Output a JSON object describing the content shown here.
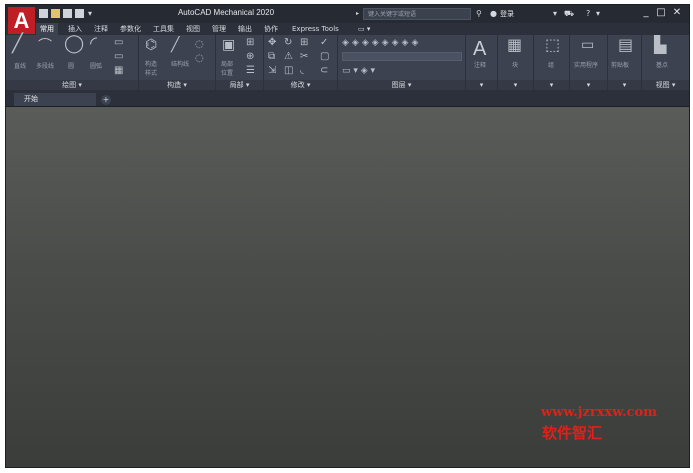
{
  "app": {
    "title": "AutoCAD Mechanical 2020",
    "logo_letter": "A"
  },
  "search": {
    "placeholder": "键入关键字或短语"
  },
  "account": {
    "login_label": "登录"
  },
  "ribbon_tabs": [
    "常用",
    "插入",
    "注释",
    "参数化",
    "工具集",
    "视图",
    "管理",
    "输出",
    "协作",
    "Express Tools"
  ],
  "ribbon": {
    "draw": {
      "title": "绘图 ▾",
      "line": "直线",
      "polyline": "多段线",
      "circle": "圆",
      "arc": "圆弧"
    },
    "construct": {
      "title": "构造 ▾",
      "structure": "构造",
      "line": "结构线",
      "style": "样式"
    },
    "detail": {
      "title": "局部 ▾",
      "label1": "局部",
      "label2": "位置"
    },
    "modify": {
      "title": "修改 ▾"
    },
    "layers": {
      "title": "图层 ▾"
    },
    "annotation": {
      "label": "注释"
    },
    "block": {
      "label": "块"
    },
    "group": {
      "label": "组"
    },
    "utilities": {
      "label": "实用程序"
    },
    "clipboard": {
      "label": "剪贴板"
    },
    "view": {
      "label": "基点",
      "title": "视图 ▾"
    }
  },
  "document_tabs": {
    "start": "开始",
    "new_tab": "+"
  },
  "window_controls": {
    "minimize": "_",
    "maximize": "□",
    "close": "✕"
  },
  "watermark": {
    "url": "www.jzrxxw.com",
    "name": "软件智汇"
  },
  "colors": {
    "logo": "#bf1f24",
    "watermark": "#e0201a",
    "ribbon": "#3c4250"
  }
}
